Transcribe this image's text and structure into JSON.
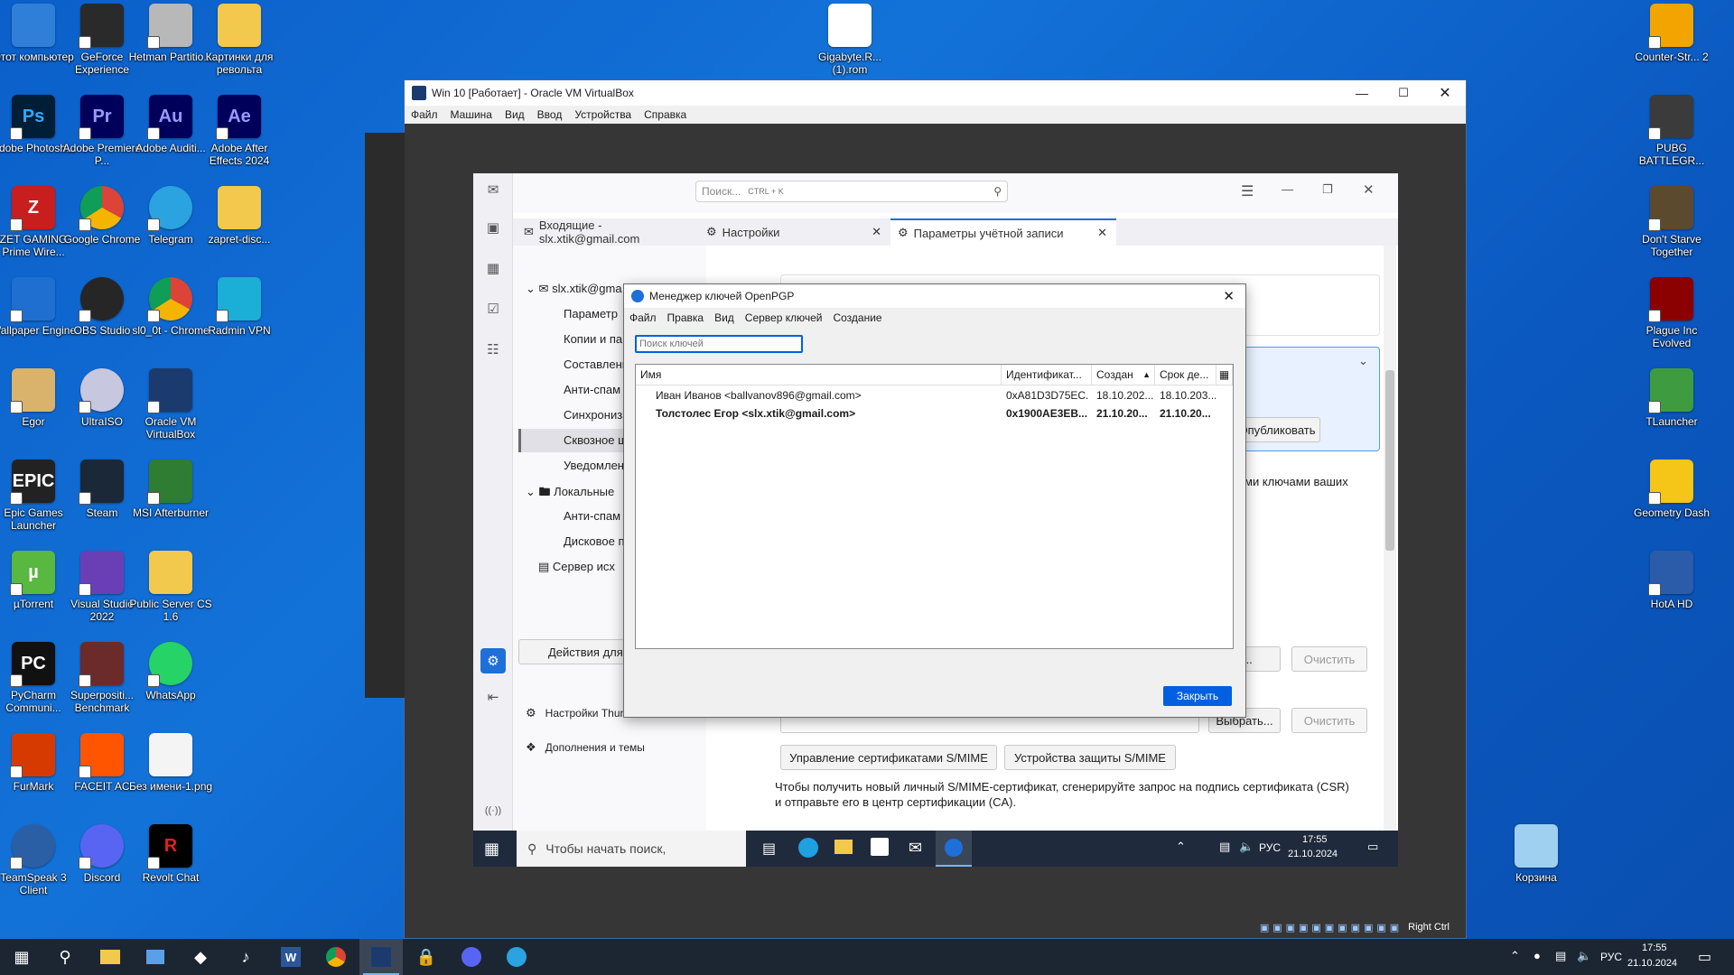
{
  "desktop": {
    "icons": [
      {
        "label": "Этот компьютер",
        "icon": "computer-icon",
        "color": "#2f7fd8"
      },
      {
        "label": "GeForce Experience",
        "icon": "nvidia-icon",
        "color": "#2a2a2a"
      },
      {
        "label": "Hetman Partitio...",
        "icon": "hetman-icon",
        "color": "#b8b8b8"
      },
      {
        "label": "Картинки для револьта",
        "icon": "folder-icon",
        "color": "#f2c94c"
      },
      {
        "label": "Adobe Photosh...",
        "icon": "photoshop-icon",
        "color": "#001e36",
        "text": "Ps",
        "fg": "#31a8ff"
      },
      {
        "label": "Adobe Premiere P...",
        "icon": "premiere-icon",
        "color": "#00005b",
        "text": "Pr",
        "fg": "#9999ff"
      },
      {
        "label": "Adobe Auditi...",
        "icon": "audition-icon",
        "color": "#00005b",
        "text": "Au",
        "fg": "#9999ff"
      },
      {
        "label": "Adobe After Effects 2024",
        "icon": "aftereffects-icon",
        "color": "#00005b",
        "text": "Ae",
        "fg": "#9999ff"
      },
      {
        "label": "ZET GAMING Prime Wire...",
        "icon": "zet-gaming-icon",
        "color": "#c81e1e",
        "text": "Z"
      },
      {
        "label": "Google Chrome",
        "icon": "chrome-icon",
        "color": "#ffffff"
      },
      {
        "label": "Telegram",
        "icon": "telegram-icon",
        "color": "#2aa3e0"
      },
      {
        "label": "zapret-disc...",
        "icon": "folder-zip-icon",
        "color": "#f2c94c"
      },
      {
        "label": "Wallpaper Engine",
        "icon": "wallpaper-engine-icon",
        "color": "#1e6fd0"
      },
      {
        "label": "OBS Studio",
        "icon": "obs-icon",
        "color": "#262626"
      },
      {
        "label": "sl0_0t - Chrome",
        "icon": "chrome-profile-icon",
        "color": "#ffffff"
      },
      {
        "label": "Radmin VPN",
        "icon": "radmin-vpn-icon",
        "color": "#1baed6"
      },
      {
        "label": "Egor",
        "icon": "egor-icon",
        "color": "#d9b36b"
      },
      {
        "label": "UltraISO",
        "icon": "ultraiso-icon",
        "color": "#c7c7e0"
      },
      {
        "label": "Oracle VM VirtualBox",
        "icon": "virtualbox-icon",
        "color": "#1b3b6f"
      },
      {
        "label": "Epic Games Launcher",
        "icon": "epic-games-icon",
        "color": "#222222",
        "text": "EPIC"
      },
      {
        "label": "Steam",
        "icon": "steam-icon",
        "color": "#1b2838"
      },
      {
        "label": "MSI Afterburner",
        "icon": "msi-afterburner-icon",
        "color": "#2e7d32"
      },
      {
        "label": "µTorrent",
        "icon": "utorrent-icon",
        "color": "#58b83f",
        "text": "µ"
      },
      {
        "label": "Visual Studio 2022",
        "icon": "visual-studio-icon",
        "color": "#6a3fb5"
      },
      {
        "label": "Public Server CS 1.6",
        "icon": "folder-icon",
        "color": "#f2c94c"
      },
      {
        "label": "PyCharm Communi...",
        "icon": "pycharm-icon",
        "color": "#111111",
        "text": "PC"
      },
      {
        "label": "Superpositi... Benchmark",
        "icon": "superposition-icon",
        "color": "#6b2b2b"
      },
      {
        "label": "WhatsApp",
        "icon": "whatsapp-icon",
        "color": "#25d366"
      },
      {
        "label": "FurMark",
        "icon": "furmark-icon",
        "color": "#d63a00"
      },
      {
        "label": "FACEIT AC",
        "icon": "faceit-icon",
        "color": "#ff5500"
      },
      {
        "label": "Без имени-1.png",
        "icon": "image-file-icon",
        "color": "#f4f4f4"
      },
      {
        "label": "TeamSpeak 3 Client",
        "icon": "teamspeak-icon",
        "color": "#2b5fa5"
      },
      {
        "label": "Discord",
        "icon": "discord-icon",
        "color": "#5865f2"
      },
      {
        "label": "Revolt Chat",
        "icon": "revolt-icon",
        "color": "#000000",
        "text": "R",
        "fg": "#e02020"
      },
      {
        "label": "Gigabyte.R... (1).rom",
        "icon": "file-icon",
        "color": "#ffffff"
      },
      {
        "label": "Counter-Str... 2",
        "icon": "counter-strike-icon",
        "color": "#f2a400"
      },
      {
        "label": "PUBG BATTLEGR...",
        "icon": "pubg-icon",
        "color": "#3b3b3b"
      },
      {
        "label": "Don't Starve Together",
        "icon": "dont-starve-icon",
        "color": "#5b4a2e"
      },
      {
        "label": "Plague Inc Evolved",
        "icon": "plague-inc-icon",
        "color": "#8b0000"
      },
      {
        "label": "TLauncher",
        "icon": "tlauncher-icon",
        "color": "#3f9b3f"
      },
      {
        "label": "Geometry Dash",
        "icon": "geometry-dash-icon",
        "color": "#f5c518"
      },
      {
        "label": "HotA HD",
        "icon": "hota-icon",
        "color": "#2a5caa"
      },
      {
        "label": "Корзина",
        "icon": "recycle-bin-icon",
        "color": "#9fd0f0"
      }
    ]
  },
  "vbox": {
    "title": "Win 10 [Работает] - Oracle VM VirtualBox",
    "menu": [
      "Файл",
      "Машина",
      "Вид",
      "Ввод",
      "Устройства",
      "Справка"
    ],
    "status_host_key": "Right Ctrl"
  },
  "thunderbird": {
    "search_placeholder": "Поиск...",
    "search_shortcut": "CTRL + K",
    "tabs": [
      {
        "label": "Входящие - slx.xtik@gmail.com"
      },
      {
        "label": "Настройки"
      },
      {
        "label": "Параметры учётной записи"
      }
    ],
    "tree": {
      "account": "slx.xtik@gma",
      "items": [
        "Параметр",
        "Копии и па",
        "Составлени",
        "Анти-спам",
        "Синхрониза",
        "Сквозное ш",
        "Уведомлен"
      ],
      "local": "Локальные",
      "local_items": [
        "Анти-спам",
        "Дисковое п"
      ],
      "outgoing": "Сервер исх"
    },
    "actions_label": "Действия для",
    "settings_link": "Настройки Thunderbird",
    "addons_link": "Дополнения и темы",
    "right": {
      "partial_text": "ми ключами ваших",
      "publish_label": "Опубликовать",
      "select_label_1": "ь...",
      "clear_label_1": "Очистить",
      "select_label_2": "Выбрать...",
      "clear_label_2": "Очистить",
      "smime_certs_label": "Управление сертификатами S/MIME",
      "smime_devices_label": "Устройства защиты S/MIME",
      "csr_text_1": "Чтобы получить новый личный S/MIME-сертификат, сгенерируйте запрос на подпись сертификата (CSR)",
      "csr_text_2": "и отправьте его в центр сертификации (CA)."
    }
  },
  "dialog": {
    "title": "Менеджер ключей OpenPGP",
    "menu": [
      "Файл",
      "Правка",
      "Вид",
      "Сервер ключей",
      "Создание"
    ],
    "search_placeholder": "Поиск ключей",
    "columns": [
      "Имя",
      "Идентификат...",
      "Создан",
      "Срок де..."
    ],
    "rows": [
      {
        "name": "Иван Иванов <ballvanov896@gmail.com>",
        "id": "0xA81D3D75EC...",
        "created": "18.10.202...",
        "expires": "18.10.203...",
        "bold": false
      },
      {
        "name": "Толстолес Егор <slx.xtik@gmail.com>",
        "id": "0x1900AE3EB...",
        "created": "21.10.20...",
        "expires": "21.10.20...",
        "bold": true
      }
    ],
    "close_label": "Закрыть"
  },
  "guest_taskbar": {
    "search_placeholder": "Чтобы начать поиск,",
    "lang": "РУС",
    "time": "17:55",
    "date": "21.10.2024"
  },
  "host_taskbar": {
    "lang": "РУС",
    "time": "17:55",
    "date": "21.10.2024"
  },
  "colors": {
    "accent": "#0060df",
    "taskbar": "#1c2633",
    "desktop": "#0b5fc9"
  }
}
